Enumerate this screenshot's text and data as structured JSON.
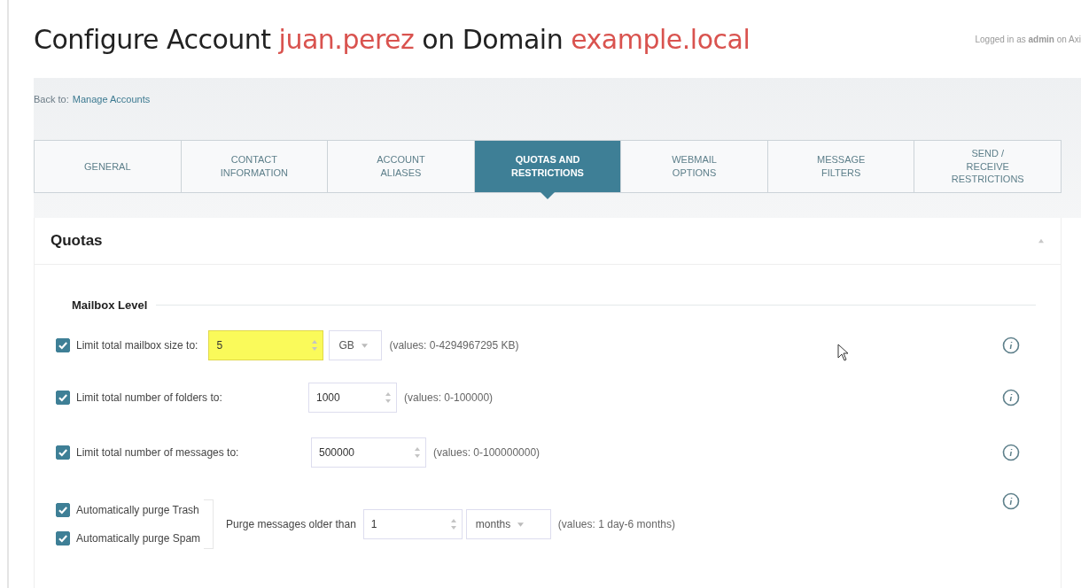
{
  "header": {
    "title_parts": [
      {
        "text": "Configure Account ",
        "accent": false
      },
      {
        "text": "juan.perez",
        "accent": true
      },
      {
        "text": " on ",
        "accent": false
      },
      {
        "text": "Domain ",
        "accent": false
      },
      {
        "text": "example.local",
        "accent": true
      }
    ],
    "login": "Logged in as **admin** on Axi"
  },
  "breadcrumb": {
    "label": "Back to:",
    "link": "Manage Accounts"
  },
  "tabs": [
    {
      "label": "GENERAL",
      "selected": false
    },
    {
      "label": "CONTACT INFORMATION",
      "selected": false
    },
    {
      "label": "ACCOUNT ALIASES",
      "selected": false
    },
    {
      "label": "QUOTAS AND RESTRICTIONS",
      "selected": true
    },
    {
      "label": "WEBMAIL OPTIONS",
      "selected": false
    },
    {
      "label": "MESSAGE FILTERS",
      "selected": false
    },
    {
      "label": "SEND / RECEIVE RESTRICTIONS",
      "selected": false
    }
  ],
  "panel": {
    "title": "Quotas",
    "expanded": true,
    "section": "Mailbox Level",
    "rows": [
      {
        "kind": "limit",
        "checked": true,
        "label": "Limit total mailbox size to:",
        "value": "5",
        "focused": true,
        "unit": "GB",
        "hint": "(values: 0-4294967295 KB)"
      },
      {
        "kind": "limit",
        "checked": true,
        "label": "Limit total number of folders to:",
        "value": "1000",
        "focused": false,
        "hint": "(values: 0-100000)"
      },
      {
        "kind": "limit",
        "checked": true,
        "label": "Limit total number of messages to:",
        "value": "500000",
        "focused": false,
        "hint": "(values: 0-100000000)"
      },
      {
        "kind": "purge",
        "options": [
          {
            "label": "Automatically purge Trash",
            "checked": true
          },
          {
            "label": "Automatically purge Spam",
            "checked": true
          }
        ],
        "label": "Purge messages older than",
        "value": "1",
        "focused": false,
        "unit": "months",
        "hint": "(values: 1 day-6 months)"
      }
    ]
  }
}
